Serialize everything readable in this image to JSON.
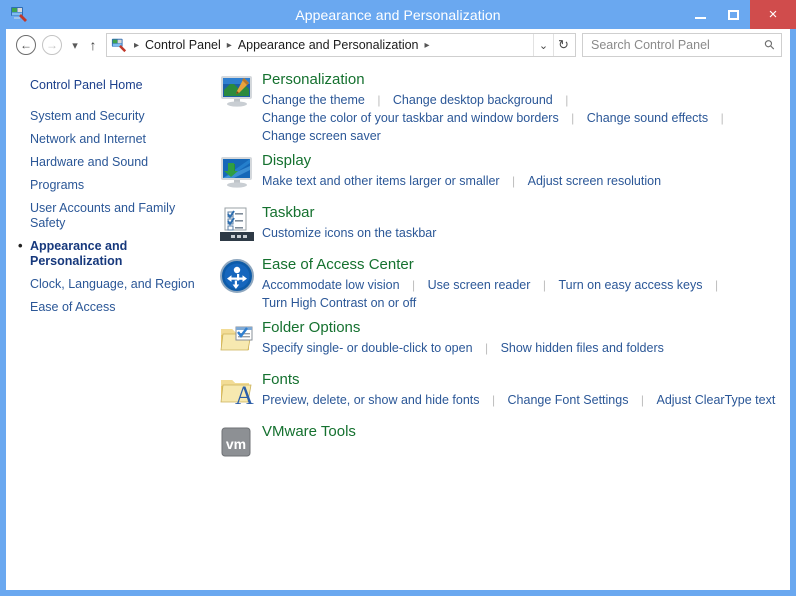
{
  "window": {
    "title": "Appearance and Personalization",
    "icon": "control-panel-icon",
    "minimize_label": "Minimize",
    "maximize_label": "Maximize",
    "close_label": "×",
    "titlebar_color": "#6aa8f0",
    "close_color": "#d04c4c"
  },
  "toolbar": {
    "back_glyph": "←",
    "forward_glyph": "→",
    "recent_glyph": "▾",
    "up_glyph": "↑",
    "breadcrumb": [
      "Control Panel",
      "Appearance and Personalization"
    ],
    "breadcrumb_sep": "▸",
    "breadcrumb_trailing_sep": "▸",
    "history_glyph": "⌄",
    "refresh_glyph": "↻"
  },
  "search": {
    "placeholder": "Search Control Panel",
    "value": "",
    "icon": "search-icon"
  },
  "sidebar": {
    "home": "Control Panel Home",
    "items": [
      {
        "label": "System and Security",
        "current": false
      },
      {
        "label": "Network and Internet",
        "current": false
      },
      {
        "label": "Hardware and Sound",
        "current": false
      },
      {
        "label": "Programs",
        "current": false
      },
      {
        "label": "User Accounts and Family Safety",
        "current": false
      },
      {
        "label": "Appearance and Personalization",
        "current": true
      },
      {
        "label": "Clock, Language, and Region",
        "current": false
      },
      {
        "label": "Ease of Access",
        "current": false
      }
    ]
  },
  "categories": [
    {
      "icon": "personalization-icon",
      "title": "Personalization",
      "links": [
        "Change the theme",
        "Change desktop background",
        "Change the color of your taskbar and window borders",
        "Change sound effects",
        "Change screen saver"
      ]
    },
    {
      "icon": "display-icon",
      "title": "Display",
      "links": [
        "Make text and other items larger or smaller",
        "Adjust screen resolution"
      ]
    },
    {
      "icon": "taskbar-icon",
      "title": "Taskbar",
      "links": [
        "Customize icons on the taskbar"
      ]
    },
    {
      "icon": "ease-of-access-icon",
      "title": "Ease of Access Center",
      "links": [
        "Accommodate low vision",
        "Use screen reader",
        "Turn on easy access keys",
        "Turn High Contrast on or off"
      ]
    },
    {
      "icon": "folder-options-icon",
      "title": "Folder Options",
      "links": [
        "Specify single- or double-click to open",
        "Show hidden files and folders"
      ]
    },
    {
      "icon": "fonts-icon",
      "title": "Fonts",
      "links": [
        "Preview, delete, or show and hide fonts",
        "Change Font Settings",
        "Adjust ClearType text"
      ]
    },
    {
      "icon": "vmware-tools-icon",
      "title": "VMware Tools",
      "links": []
    }
  ],
  "colors": {
    "heading_green": "#15712f",
    "link_blue": "#2b5797",
    "frame_blue": "#6aa8f0"
  }
}
